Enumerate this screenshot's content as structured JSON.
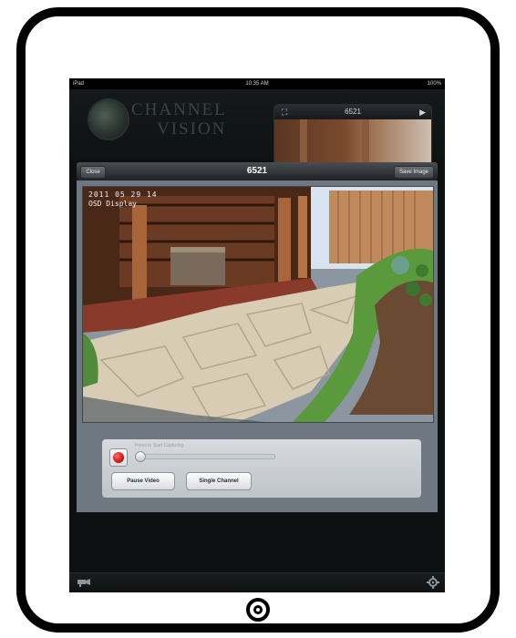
{
  "statusbar": {
    "carrier": "iPad",
    "time": "10:35 AM",
    "battery": "100%"
  },
  "brand": {
    "line1": "CHANNEL",
    "line2": "VISION"
  },
  "thumbnail": {
    "title": "6521",
    "expand_icon": "expand-icon",
    "play_icon": "play-icon"
  },
  "viewer": {
    "title": "6521",
    "close_label": "Close",
    "save_label": "Save Image",
    "osd_timestamp": "2011 05 29 14",
    "osd_caption": "OSD Display"
  },
  "recording": {
    "label": "Press to Start Capturing",
    "level": 0.0
  },
  "controls": {
    "pause_label": "Pause Video",
    "single_label": "Single Channel"
  },
  "colors": {
    "record_red": "#d11717",
    "screen_bg": "#0d0f10",
    "panel_bg": "#6f7880"
  },
  "icons": {
    "bottom_left": "camera-icon",
    "bottom_right": "gear-icon"
  }
}
